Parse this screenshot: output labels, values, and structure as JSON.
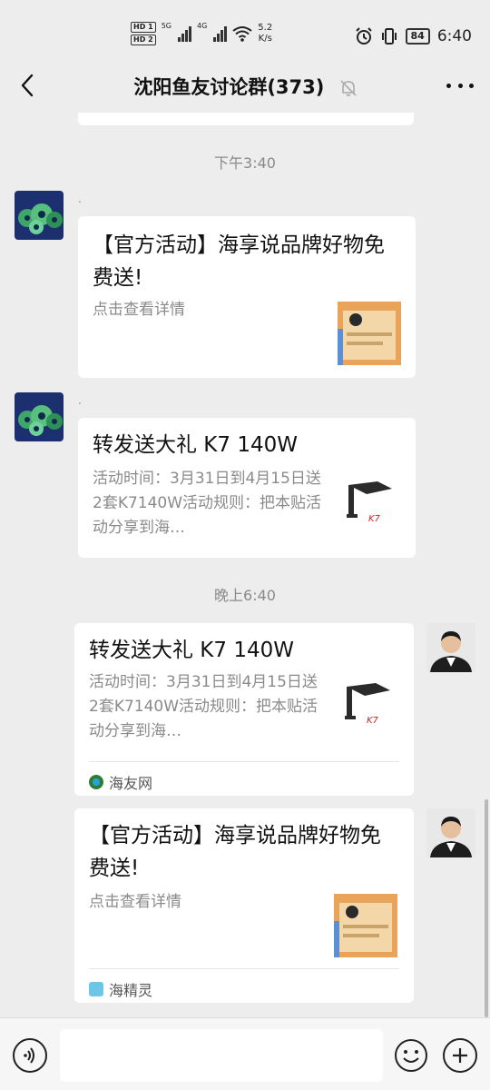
{
  "status_bar": {
    "hd1": "HD 1",
    "hd2": "HD 2",
    "net1": "5G",
    "net2": "4G",
    "speed_value": "5.2",
    "speed_unit": "K/s",
    "battery": "84",
    "time": "6:40"
  },
  "header": {
    "title": "沈阳鱼友讨论群(373)"
  },
  "chat": {
    "time_labels": [
      "下午3:40",
      "晚上6:40"
    ],
    "messages": [
      {
        "nick": ".",
        "title": "【官方活动】海享说品牌好物免费送!",
        "desc": "点击查看详情"
      },
      {
        "nick": ".",
        "title": "转发送大礼 K7 140W",
        "desc": "活动时间：3月31日到4月15日送2套K7140W活动规则：把本贴活动分享到海…"
      },
      {
        "title": "转发送大礼 K7 140W",
        "desc": "活动时间：3月31日到4月15日送2套K7140W活动规则：把本贴活动分享到海…",
        "source": "海友网"
      },
      {
        "title": "【官方活动】海享说品牌好物免费送!",
        "desc": "点击查看详情",
        "source": "海精灵"
      }
    ]
  },
  "colors": {
    "background": "#ededed",
    "card": "#ffffff",
    "muted_text": "#8a8a8a"
  }
}
